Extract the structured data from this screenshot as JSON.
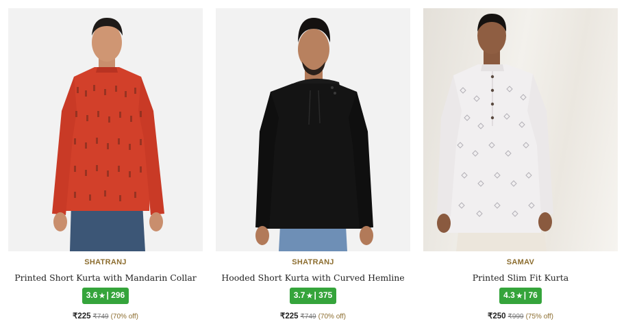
{
  "products": [
    {
      "brand": "SHATRANJ",
      "name": "Printed Short Kurta with Mandarin Collar",
      "rating": "3.6",
      "star": "★",
      "rating_sep": "|",
      "review_count": "296",
      "price": "₹225",
      "mrp": "₹749",
      "discount": "(70% off)",
      "image": {
        "subject": "man-in-red-printed-kurta",
        "garment_color": "#d2402a",
        "background": "#f2f2f2"
      }
    },
    {
      "brand": "SHATRANJ",
      "name": "Hooded Short Kurta with Curved Hemline",
      "rating": "3.7",
      "star": "★",
      "rating_sep": "|",
      "review_count": "375",
      "price": "₹225",
      "mrp": "₹749",
      "discount": "(70% off)",
      "image": {
        "subject": "man-in-black-hooded-kurta",
        "garment_color": "#141414",
        "background": "#f2f2f2"
      }
    },
    {
      "brand": "SAMAV",
      "name": "Printed Slim Fit Kurta",
      "rating": "4.3",
      "star": "★",
      "rating_sep": "|",
      "review_count": "76",
      "price": "₹250",
      "mrp": "₹999",
      "discount": "(75% off)",
      "image": {
        "subject": "man-in-white-printed-kurta",
        "garment_color": "#f1eff0",
        "background": "#ebe7e0"
      }
    }
  ],
  "colors": {
    "brand_text": "#8c6d2f",
    "rating_badge": "#35a43b"
  }
}
